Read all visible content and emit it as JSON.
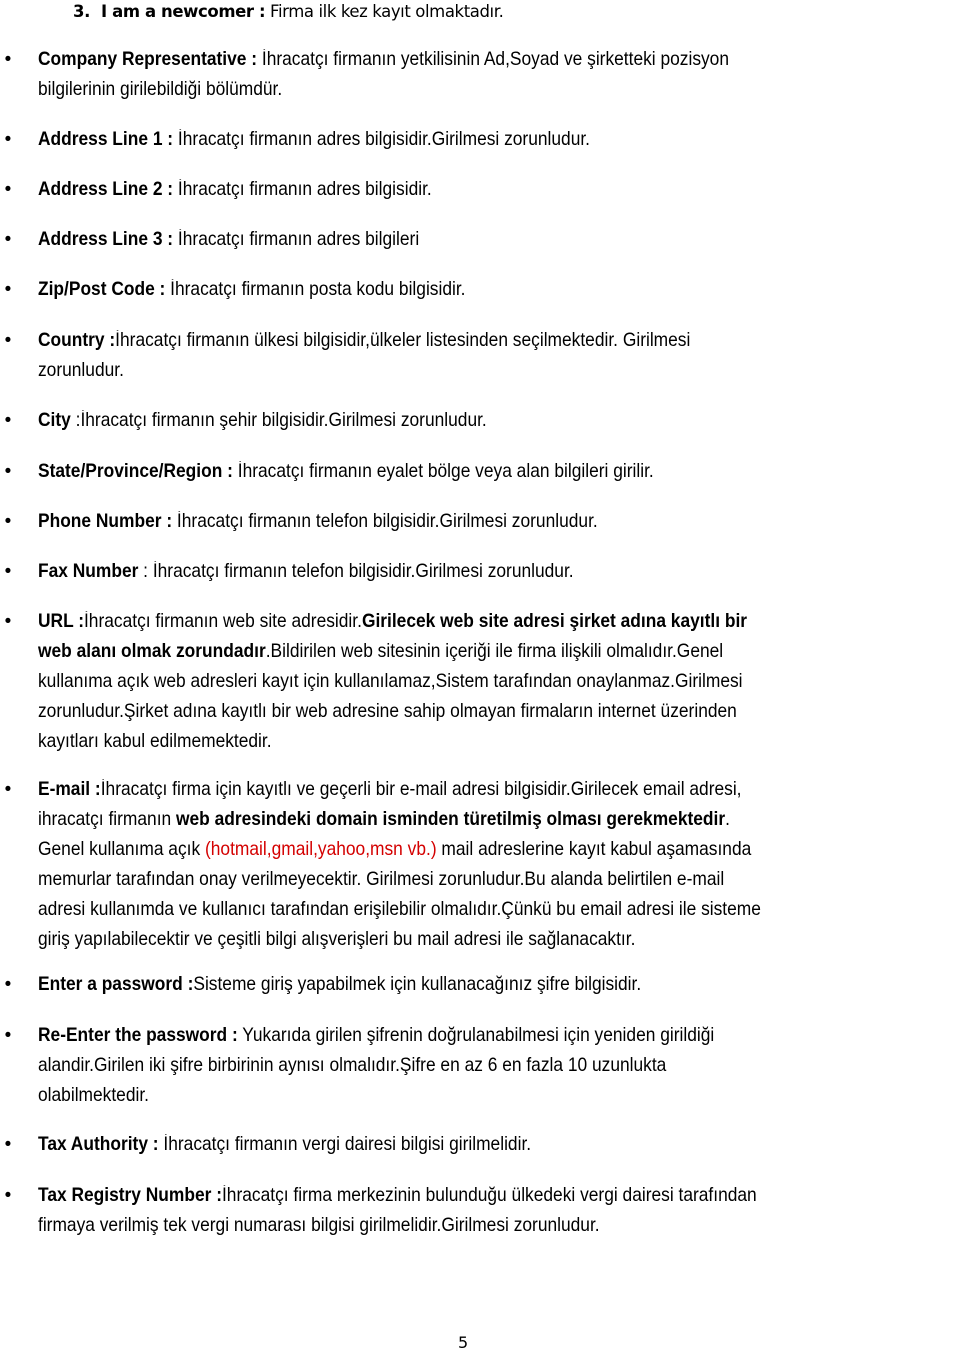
{
  "heading": {
    "number": "3.",
    "label": "I am a newcomer :",
    "text": " Firma ilk kez kayıt olmaktadır."
  },
  "items": [
    {
      "label": "Company Representative :",
      "segments": [
        {
          "text": " İhracatçı firmanın yetkilisinin Ad,Soyad ve şirketteki pozisyon",
          "style": "normal"
        },
        {
          "br": true
        },
        {
          "text": "bilgilerinin girilebildiği bölümdür.",
          "style": "normal"
        }
      ]
    },
    {
      "label": "Address Line 1 :",
      "segments": [
        {
          "text": " İhracatçı firmanın adres bilgisidir.Girilmesi zorunludur.",
          "style": "normal"
        }
      ]
    },
    {
      "label": "Address Line 2 :",
      "segments": [
        {
          "text": " İhracatçı firmanın adres bilgisidir.",
          "style": "normal"
        }
      ]
    },
    {
      "label": "Address Line 3 :",
      "segments": [
        {
          "text": " İhracatçı firmanın adres bilgileri",
          "style": "normal"
        }
      ]
    },
    {
      "label": "Zip/Post Code :",
      "segments": [
        {
          "text": " İhracatçı firmanın posta kodu bilgisidir.",
          "style": "normal"
        }
      ]
    },
    {
      "label": "Country :",
      "segments": [
        {
          "text": "İhracatçı firmanın ülkesi bilgisidir,ülkeler listesinden seçilmektedir. Girilmesi",
          "style": "normal"
        },
        {
          "br": true
        },
        {
          "text": "zorunludur.",
          "style": "normal"
        }
      ]
    },
    {
      "label": "City",
      "segments": [
        {
          "text": " :İhracatçı firmanın şehir bilgisidir.Girilmesi zorunludur.",
          "style": "normal"
        }
      ]
    },
    {
      "label": "State/Province/Region :",
      "segments": [
        {
          "text": " İhracatçı firmanın eyalet bölge veya alan bilgileri girilir.",
          "style": "normal"
        }
      ]
    },
    {
      "label": "Phone Number :",
      "segments": [
        {
          "text": " İhracatçı firmanın telefon bilgisidir.Girilmesi zorunludur.",
          "style": "normal"
        }
      ]
    },
    {
      "label": "Fax Number",
      "segments": [
        {
          "text": " : İhracatçı firmanın telefon bilgisidir.Girilmesi zorunludur.",
          "style": "normal"
        }
      ]
    },
    {
      "label": "URL :",
      "segments": [
        {
          "text": "İhracatçı firmanın web site adresidir.",
          "style": "normal"
        },
        {
          "text": "Girilecek web site adresi şirket adına kayıtlı bir",
          "style": "bold"
        },
        {
          "br": true
        },
        {
          "text": "web alanı olmak zorundadır",
          "style": "bold"
        },
        {
          "text": ".Bildirilen web sitesinin içeriği ile firma ilişkili olmalıdır.Genel",
          "style": "normal"
        },
        {
          "br": true
        },
        {
          "text": "kullanıma açık web adresleri kayıt için kullanılamaz,Sistem tarafından onaylanmaz.Girilmesi",
          "style": "normal"
        },
        {
          "br": true
        },
        {
          "text": "zorunludur.Şirket adına kayıtlı bir web adresine sahip olmayan firmaların internet üzerinden",
          "style": "normal"
        },
        {
          "br": true
        },
        {
          "text": "kayıtları kabul edilmemektedir.",
          "style": "normal"
        }
      ]
    },
    {
      "label": "E-mail :",
      "segments": [
        {
          "text": "İhracatçı firma için kayıtlı ve geçerli bir e-mail adresi bilgisidir.Girilecek email adresi,",
          "style": "normal"
        },
        {
          "br": true
        },
        {
          "text": "ihracatçı firmanın ",
          "style": "normal"
        },
        {
          "text": "web adresindeki domain isminden türetilmiş olması gerekmektedir",
          "style": "bold"
        },
        {
          "text": ".",
          "style": "normal"
        },
        {
          "br": true
        },
        {
          "text": "Genel kullanıma açık ",
          "style": "normal"
        },
        {
          "text": "(hotmail,gmail,yahoo,msn vb.)",
          "style": "red"
        },
        {
          "text": " mail adreslerine kayıt kabul aşamasında",
          "style": "normal"
        },
        {
          "br": true
        },
        {
          "text": "memurlar tarafından onay verilmeyecektir. Girilmesi zorunludur.Bu alanda belirtilen e-mail",
          "style": "normal"
        },
        {
          "br": true
        },
        {
          "text": "adresi kullanımda ve kullanıcı tarafından erişilebilir olmalıdır.Çünkü bu  email adresi ile sisteme",
          "style": "normal"
        },
        {
          "br": true
        },
        {
          "text": "giriş yapılabilecektir ve çeşitli bilgi alışverişleri bu mail adresi ile sağlanacaktır.",
          "style": "normal"
        }
      ]
    },
    {
      "label": "Enter a password :",
      "segments": [
        {
          "text": "Sisteme giriş yapabilmek için kullanacağınız şifre bilgisidir.",
          "style": "normal"
        }
      ]
    },
    {
      "label": "Re-Enter the password :",
      "segments": [
        {
          "text": " Yukarıda girilen şifrenin doğrulanabilmesi için yeniden girildiği",
          "style": "normal"
        },
        {
          "br": true
        },
        {
          "text": "alandir.Girilen iki şifre birbirinin aynısı olmalıdır.Şifre en az 6 en fazla 10 uzunlukta",
          "style": "normal"
        },
        {
          "br": true
        },
        {
          "text": "olabilmektedir.",
          "style": "normal"
        }
      ]
    },
    {
      "label": "Tax Authority :",
      "segments": [
        {
          "text": " İhracatçı firmanın vergi dairesi bilgisi girilmelidir.",
          "style": "normal"
        }
      ]
    },
    {
      "label": "Tax Registry Number :",
      "segments": [
        {
          "text": "İhracatçı firma merkezinin bulunduğu ülkedeki vergi dairesi tarafından",
          "style": "normal"
        },
        {
          "br": true
        },
        {
          "text": "firmaya verilmiş tek vergi numarası bilgisi girilmelidir.Girilmesi zorunludur.",
          "style": "normal"
        }
      ]
    }
  ],
  "bullet_glyph": "•",
  "page_number": "5",
  "colors": {
    "text": "#000000",
    "highlight_red": "#d40000"
  }
}
